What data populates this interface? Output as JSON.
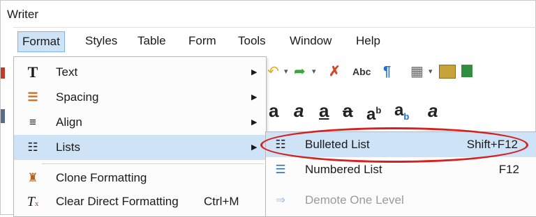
{
  "app_title": "Writer",
  "menubar": {
    "items": [
      "Format",
      "Styles",
      "Table",
      "Form",
      "Tools",
      "Window",
      "Help"
    ]
  },
  "format_menu": {
    "items": [
      {
        "icon": "text-icon",
        "label": "Text",
        "has_submenu": true
      },
      {
        "icon": "spacing-icon",
        "label": "Spacing",
        "has_submenu": true
      },
      {
        "icon": "align-icon",
        "label": "Align",
        "has_submenu": true
      },
      {
        "icon": "lists-icon",
        "label": "Lists",
        "has_submenu": true,
        "highlighted": true
      },
      {
        "icon": "clone-formatting-icon",
        "label": "Clone Formatting"
      },
      {
        "icon": "clear-formatting-icon",
        "label": "Clear Direct Formatting",
        "shortcut": "Ctrl+M"
      }
    ]
  },
  "lists_submenu": {
    "items": [
      {
        "icon": "bulleted-list-icon",
        "label": "Bulleted List",
        "shortcut": "Shift+F12",
        "highlighted": true
      },
      {
        "icon": "numbered-list-icon",
        "label": "Numbered List",
        "shortcut": "F12"
      },
      {
        "icon": "demote-arrow-icon",
        "label": "Demote One Level",
        "disabled": true
      }
    ]
  },
  "toolbar": {
    "spell_label": "Abc"
  },
  "colors": {
    "highlight": "#cfe3f6",
    "annotation": "#d42121"
  }
}
